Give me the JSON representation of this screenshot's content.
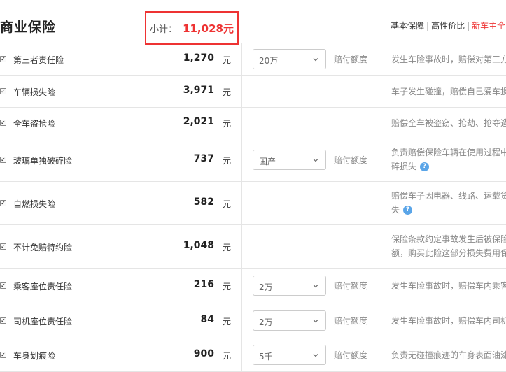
{
  "header": {
    "title": "商业保险",
    "subtotal_label": "小计：",
    "subtotal_value": "11,028元",
    "links": [
      "基本保障",
      "高性价比",
      "新车主全"
    ]
  },
  "unit": "元",
  "rows": [
    {
      "name": "第三者责任险",
      "amount": "1,270",
      "select": "20万",
      "select_label": "赔付额度",
      "desc": [
        "发生车险事故时，赔偿对第三方"
      ],
      "help": false
    },
    {
      "name": "车辆损失险",
      "amount": "3,971",
      "select": null,
      "desc": [
        "车子发生碰撞，赔偿自己爱车损"
      ],
      "help": false
    },
    {
      "name": "全车盗抢险",
      "amount": "2,021",
      "select": null,
      "desc": [
        "赔偿全车被盗窃、抢劫、抢夺造"
      ],
      "help": false
    },
    {
      "name": "玻璃单独破碎险",
      "amount": "737",
      "select": "国产",
      "select_label": "赔付额度",
      "desc": [
        "负责赔偿保险车辆在使用过程中",
        "碎损失"
      ],
      "help": true
    },
    {
      "name": "自燃损失险",
      "amount": "582",
      "select": null,
      "desc": [
        "赔偿车子因电器、线路、运载货",
        "失"
      ],
      "help": true
    },
    {
      "name": "不计免赔特约险",
      "amount": "1,048",
      "select": null,
      "desc": [
        "保险条款约定事故发生后被保险",
        "额，购买此险这部分损失费用保"
      ],
      "help": false
    },
    {
      "name": "乘客座位责任险",
      "amount": "216",
      "select": "2万",
      "select_label": "赔付额度",
      "desc": [
        "发生车险事故时，赔偿车内乘客"
      ],
      "help": false
    },
    {
      "name": "司机座位责任险",
      "amount": "84",
      "select": "2万",
      "select_label": "赔付额度",
      "desc": [
        "发生车险事故时，赔偿车内司机"
      ],
      "help": false
    },
    {
      "name": "车身划痕险",
      "amount": "900",
      "select": "5千",
      "select_label": "赔付额度",
      "desc": [
        "负责无碰撞痕迹的车身表面油漆"
      ],
      "help": false
    }
  ]
}
